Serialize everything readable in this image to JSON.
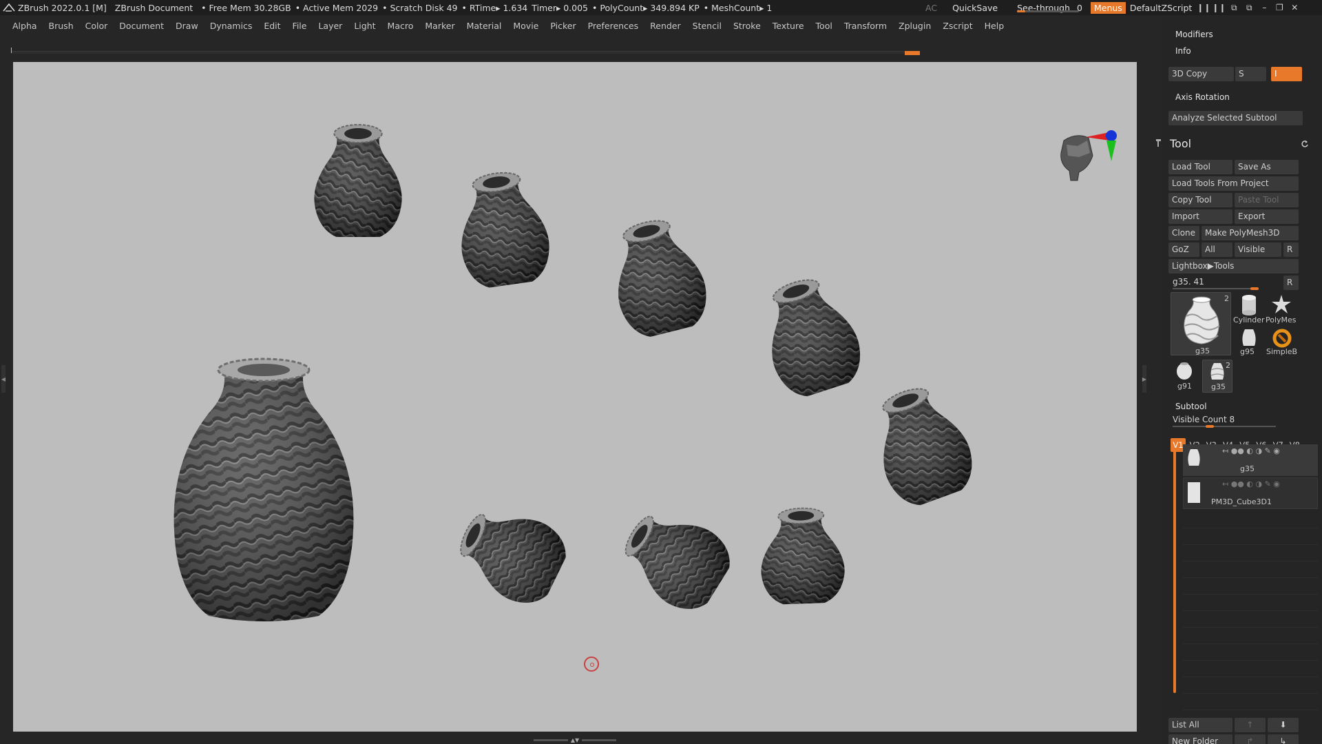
{
  "titlebar": {
    "app": "ZBrush 2022.0.1 [M]",
    "document": "ZBrush Document",
    "free_mem": "• Free Mem 30.28GB",
    "active_mem": "• Active Mem 2029",
    "scratch": "• Scratch Disk 49",
    "rtime": "• RTime▸ 1.634",
    "timer": "Timer▸ 0.005",
    "polycount": "• PolyCount▸ 349.894 KP",
    "meshcount": "• MeshCount▸ 1",
    "ac": "AC",
    "quicksave": "QuickSave",
    "see_through_label": "See-through",
    "see_through_value": "0",
    "see_through_level": 0,
    "menus": "Menus",
    "script": "DefaultZScript"
  },
  "menubar": [
    "Alpha",
    "Brush",
    "Color",
    "Document",
    "Draw",
    "Dynamics",
    "Edit",
    "File",
    "Layer",
    "Light",
    "Macro",
    "Marker",
    "Material",
    "Movie",
    "Picker",
    "Preferences",
    "Render",
    "Stencil",
    "Stroke",
    "Texture",
    "Tool",
    "Transform",
    "Zplugin",
    "Zscript",
    "Help"
  ],
  "panel": {
    "modifiers": "Modifiers",
    "info": "Info",
    "copy3d": "3D Copy",
    "s_label": "S",
    "i_label": "I",
    "axis_rotation": "Axis Rotation",
    "analyze": "Analyze Selected Subtool",
    "tool_title": "Tool",
    "load_tool": "Load Tool",
    "save_as": "Save As",
    "load_from_project": "Load Tools From Project",
    "copy_tool": "Copy Tool",
    "paste_tool": "Paste Tool",
    "import": "Import",
    "export": "Export",
    "clone": "Clone",
    "make_polymesh": "Make PolyMesh3D",
    "goz": "GoZ",
    "all": "All",
    "visible": "Visible",
    "r": "R",
    "lightbox": "Lightbox▶Tools",
    "tool_slider": "g35. 41",
    "tool_slider_r": "R",
    "thumbs": {
      "main": "g35",
      "main_count": "2",
      "cylinder": "Cylinder",
      "polymesh": "PolyMes",
      "g95": "g95",
      "simpleb": "SimpleB",
      "g91": "g91",
      "g35b": "g35",
      "g35b_count": "2"
    },
    "subtool": "Subtool",
    "visible_count": "Visible Count 8",
    "vtabs": [
      "V1",
      "V2",
      "V3",
      "V4",
      "V5",
      "V6",
      "V7",
      "V8"
    ],
    "subtools": [
      "g35",
      "PM3D_Cube3D1"
    ],
    "list_all": "List All",
    "new_folder": "New Folder"
  },
  "colors": {
    "accent": "#e8792a",
    "canvas": "#bdbdbd",
    "panel": "#252525"
  }
}
